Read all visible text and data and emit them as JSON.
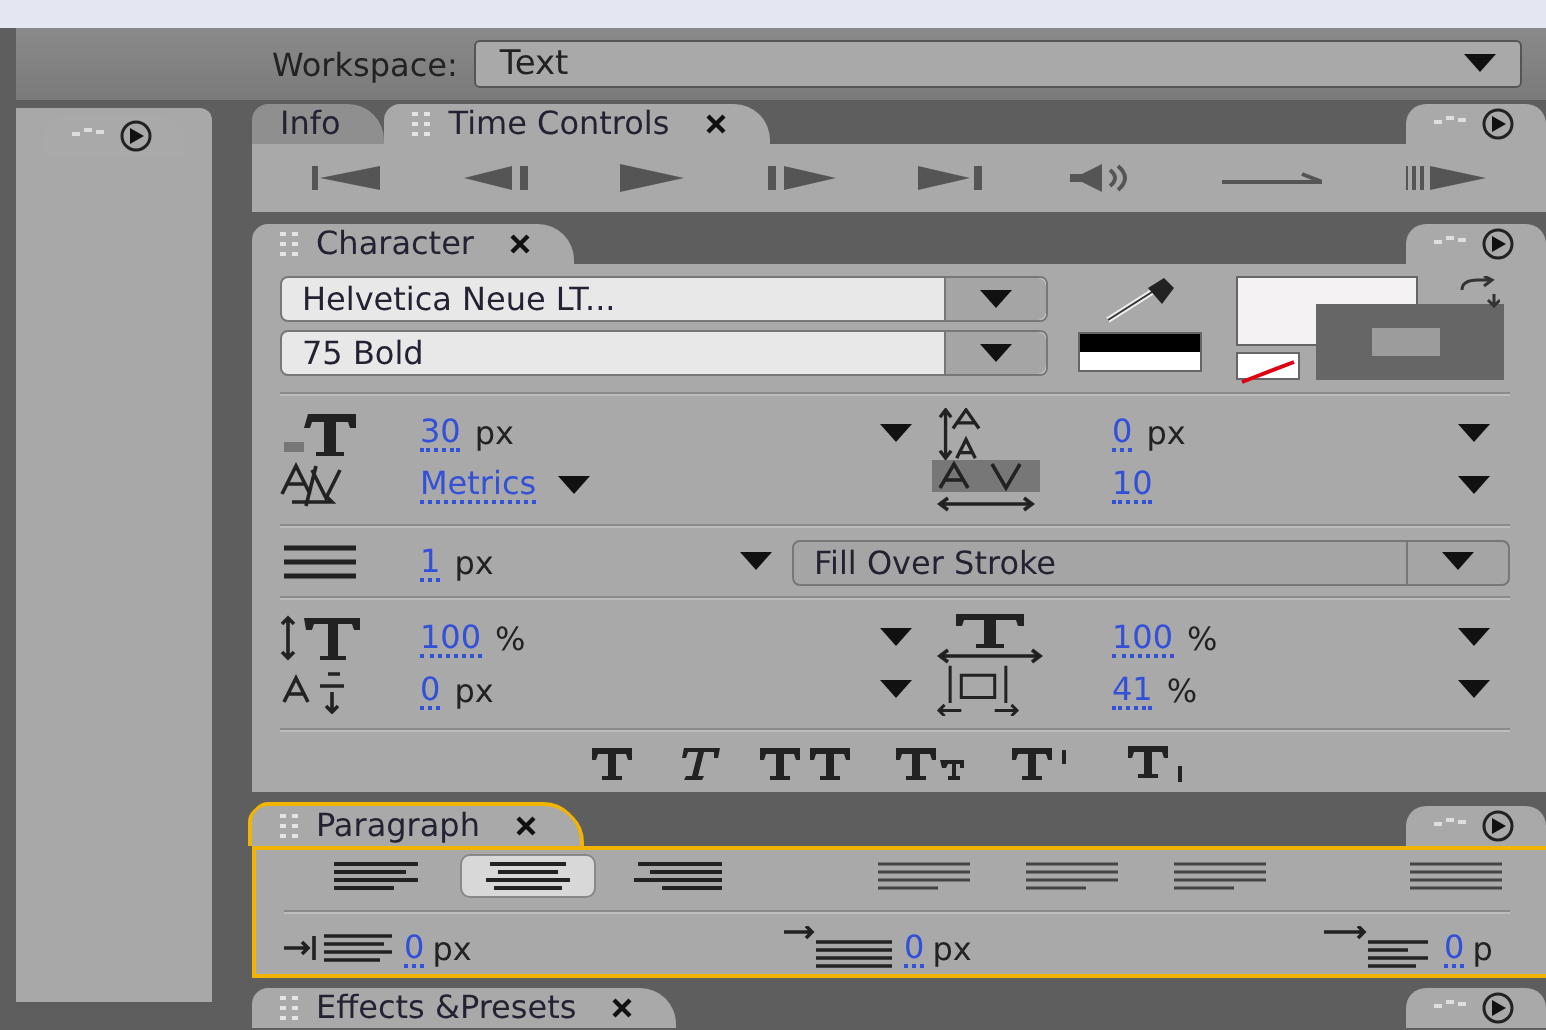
{
  "workspace": {
    "label": "Workspace:",
    "value": "Text"
  },
  "time_panel": {
    "tabs": [
      {
        "label": "Info",
        "selected": false
      },
      {
        "label": "Time Controls",
        "selected": true
      }
    ]
  },
  "character": {
    "title": "Character",
    "font_family": "Helvetica Neue LT...",
    "font_style": "75 Bold",
    "metrics": [
      {
        "kind": "size",
        "value": "30",
        "unit": "px"
      },
      {
        "kind": "leading",
        "value": "0",
        "unit": "px"
      },
      {
        "kind": "kerning",
        "value": "Metrics"
      },
      {
        "kind": "tracking",
        "value": "10"
      }
    ],
    "stroke": {
      "value": "1",
      "unit": "px",
      "style": "Fill Over Stroke"
    },
    "scales": [
      {
        "kind": "vscale",
        "value": "100",
        "unit": "%"
      },
      {
        "kind": "hscale",
        "value": "100",
        "unit": "%"
      },
      {
        "kind": "baseline",
        "value": "0",
        "unit": "px"
      },
      {
        "kind": "tsume",
        "value": "41",
        "unit": "%"
      }
    ]
  },
  "paragraph": {
    "title": "Paragraph",
    "focused": true,
    "alignments": [
      {
        "selected": false
      },
      {
        "selected": true
      },
      {
        "selected": false
      },
      {
        "selected": false
      },
      {
        "selected": false
      },
      {
        "selected": false
      },
      {
        "selected": false
      }
    ],
    "indents": [
      {
        "kind": "left",
        "value": "0",
        "unit": "px"
      },
      {
        "kind": "first",
        "value": "0",
        "unit": "px"
      },
      {
        "kind": "right",
        "value": "0",
        "unit": "p"
      }
    ]
  },
  "effects": {
    "title": "Effects &Presets"
  }
}
